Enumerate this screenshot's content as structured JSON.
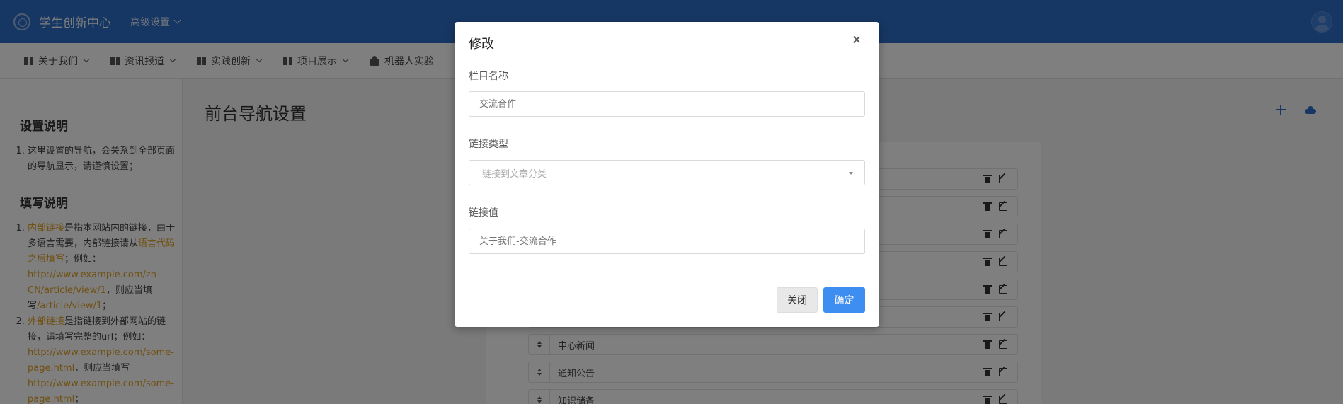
{
  "topbar": {
    "app_title": "学生创新中心",
    "adv_settings": "高级设置"
  },
  "navbar": {
    "items": [
      {
        "label": "关于我们",
        "icon": "book-icon"
      },
      {
        "label": "资讯报道",
        "icon": "book-icon"
      },
      {
        "label": "实践创新",
        "icon": "book-icon"
      },
      {
        "label": "项目展示",
        "icon": "book-icon"
      },
      {
        "label": "机器人实验",
        "icon": "puzzle-icon"
      }
    ]
  },
  "sidebar": {
    "settings_heading": "设置说明",
    "settings_note": "这里设置的导航，会关系到全部页面的导航显示，请谨慎设置；",
    "fill_heading": "填写说明",
    "internal": {
      "term": "内部链接",
      "text1": "是指本网站内的链接，由于多语言需要，内部链接请从",
      "term2": "语言代码之后填写",
      "text2": "；例如：",
      "example_url": "http://www.example.com/zh-CN/article/view/1",
      "text3": "，则应当填写",
      "fill_value": "/article/view/1",
      "text4": "；"
    },
    "external": {
      "term": "外部链接",
      "text1": "是指链接到外部网站的链接，请填写完整的url；例如：",
      "example_url": "http://www.example.com/some-page.html",
      "text2": "，则应当填写",
      "fill_value": "http://www.example.com/some-page.html",
      "text3": "；"
    }
  },
  "main": {
    "page_title": "前台导航设置",
    "rows": [
      {
        "label": ""
      },
      {
        "label": ""
      },
      {
        "label": ""
      },
      {
        "label": ""
      },
      {
        "label": ""
      },
      {
        "label": ""
      },
      {
        "label": "中心新闻"
      },
      {
        "label": "通知公告"
      },
      {
        "label": "知识储备"
      }
    ]
  },
  "modal": {
    "title": "修改",
    "name_label": "栏目名称",
    "name_placeholder": "交流合作",
    "type_label": "链接类型",
    "type_value": "链接到文章分类",
    "value_label": "链接值",
    "value_placeholder": "关于我们-交流合作",
    "close_label": "关闭",
    "ok_label": "确定"
  },
  "colors": {
    "brand": "#2d6ec8",
    "primary_button": "#3d8ef0",
    "highlight": "#e0a020"
  }
}
